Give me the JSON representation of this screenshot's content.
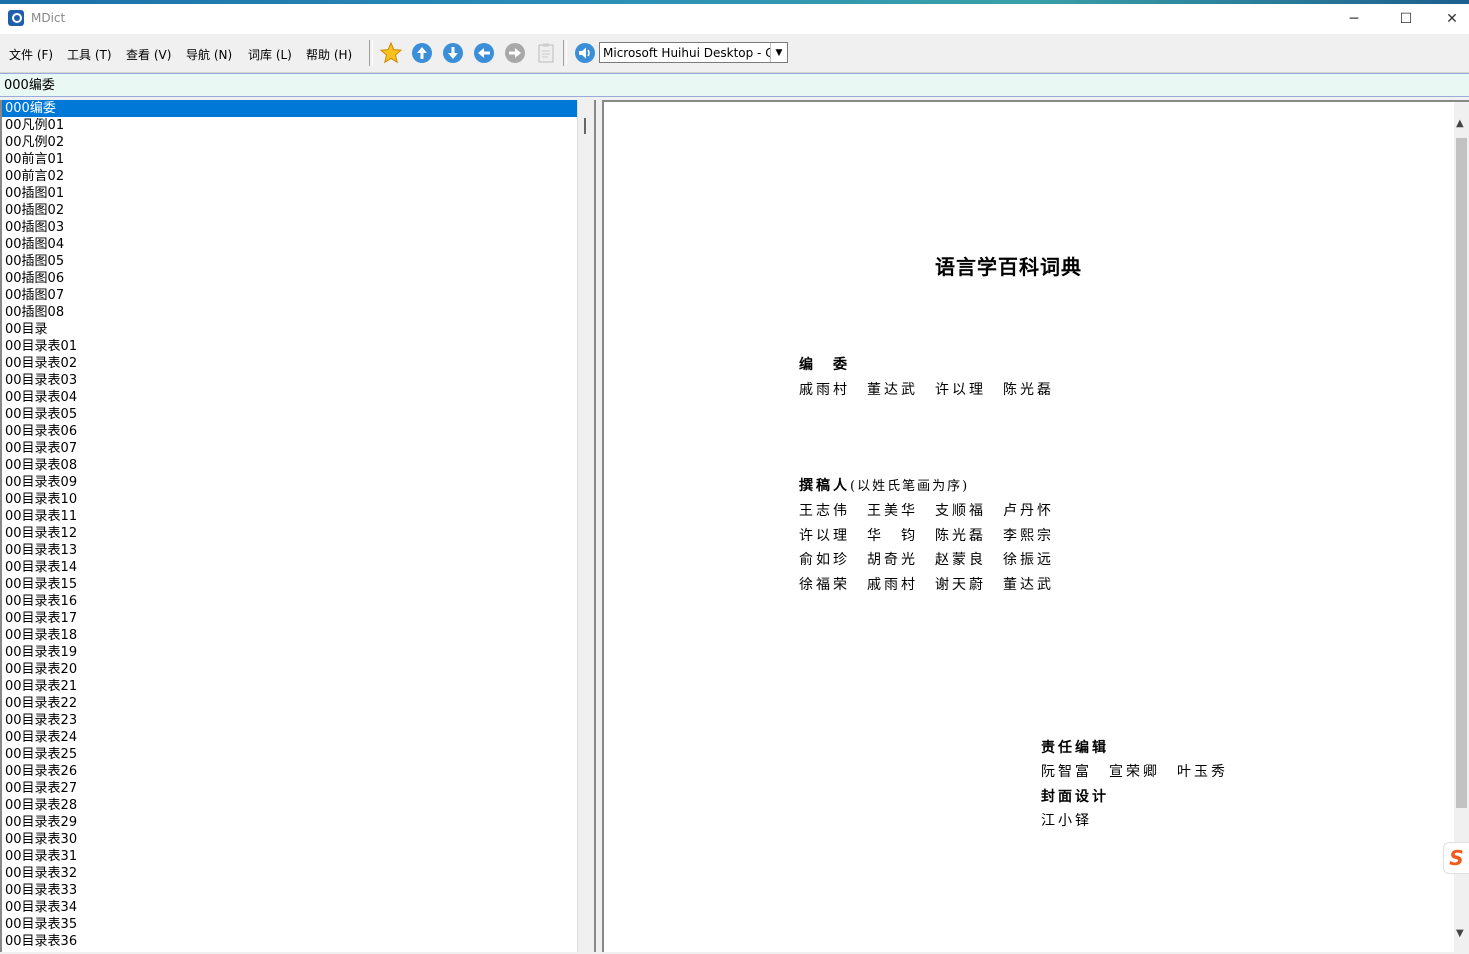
{
  "window": {
    "title": "MDict"
  },
  "menu": [
    "文件 (F)",
    "工具 (T)",
    "查看 (V)",
    "导航 (N)",
    "词库 (L)",
    "帮助 (H)"
  ],
  "toolbar": {
    "icons": [
      "star-icon",
      "arrow-up-icon",
      "arrow-down-icon",
      "arrow-left-icon",
      "arrow-right-icon",
      "clipboard-icon",
      "speaker-icon"
    ],
    "font_select_value": "Microsoft Huihui Desktop - C"
  },
  "search": {
    "value": "000编委"
  },
  "entries": [
    "000编委",
    "00凡例01",
    "00凡例02",
    "00前言01",
    "00前言02",
    "00插图01",
    "00插图02",
    "00插图03",
    "00插图04",
    "00插图05",
    "00插图06",
    "00插图07",
    "00插图08",
    "00目录",
    "00目录表01",
    "00目录表02",
    "00目录表03",
    "00目录表04",
    "00目录表05",
    "00目录表06",
    "00目录表07",
    "00目录表08",
    "00目录表09",
    "00目录表10",
    "00目录表11",
    "00目录表12",
    "00目录表13",
    "00目录表14",
    "00目录表15",
    "00目录表16",
    "00目录表17",
    "00目录表18",
    "00目录表19",
    "00目录表20",
    "00目录表21",
    "00目录表22",
    "00目录表23",
    "00目录表24",
    "00目录表25",
    "00目录表26",
    "00目录表27",
    "00目录表28",
    "00目录表29",
    "00目录表30",
    "00目录表31",
    "00目录表32",
    "00目录表33",
    "00目录表34",
    "00目录表35",
    "00目录表36"
  ],
  "selected_index": 0,
  "document": {
    "book_title": "语言学百科词典",
    "committee_heading": "编　委",
    "committee": "戚雨村　董达武　许以理　陈光磊",
    "authors_heading": "撰稿人",
    "authors_note": "(以姓氏笔画为序)",
    "authors": [
      "王志伟　王美华　支顺福　卢丹怀",
      "许以理　华　钧　陈光磊　李熙宗",
      "俞如珍　胡奇光　赵蒙良　徐振远",
      "徐福荣　戚雨村　谢天蔚　董达武"
    ],
    "editors_heading": "责任编辑",
    "editors": "阮智富　宣荣卿　叶玉秀",
    "cover_heading": "封面设计",
    "cover": "江小铎"
  },
  "colors": {
    "selection": "#0078d7",
    "accent_blue": "#3a8fd8",
    "search_bg": "#eaf8f3"
  }
}
